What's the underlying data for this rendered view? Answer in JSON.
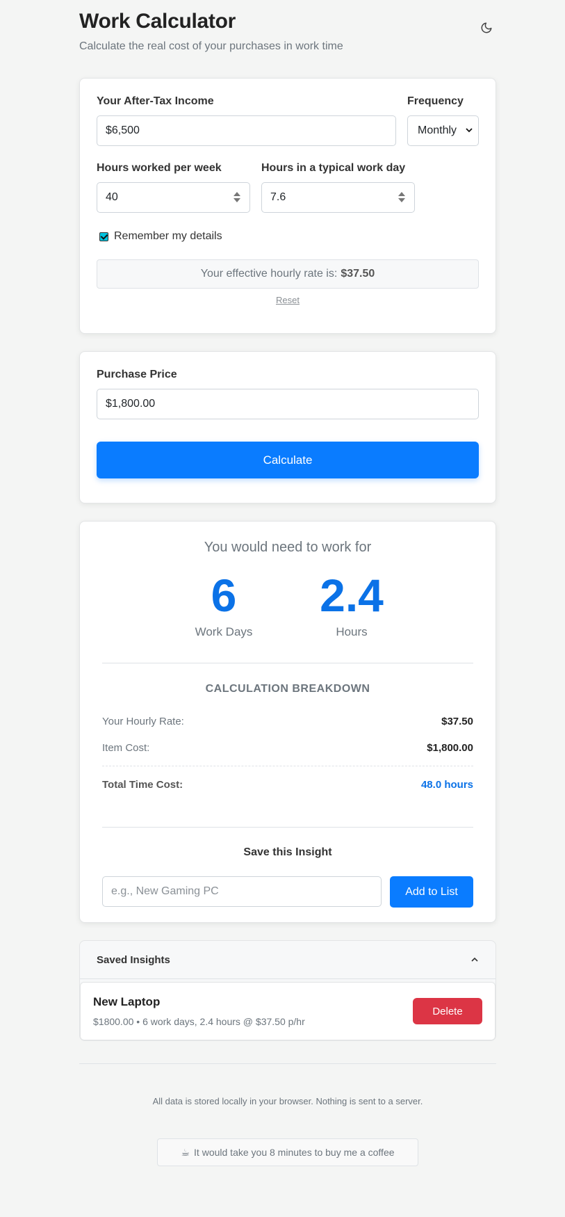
{
  "header": {
    "title": "Work Calculator",
    "subtitle": "Calculate the real cost of your purchases in work time",
    "theme_icon": "moon-icon"
  },
  "income": {
    "income_label": "Your After-Tax Income",
    "income_value": "$6,500",
    "frequency_label": "Frequency",
    "frequency_value": "Monthly",
    "hours_week_label": "Hours worked per week",
    "hours_week_value": "40",
    "hours_day_label": "Hours in a typical work day",
    "hours_day_value": "7.6",
    "remember_label": "Remember my details",
    "remember_checked": true,
    "rate_text": "Your effective hourly rate is:",
    "rate_value": "$37.50",
    "reset_label": "Reset"
  },
  "purchase": {
    "price_label": "Purchase Price",
    "price_value": "$1,800.00",
    "calculate_label": "Calculate"
  },
  "result": {
    "lead": "You would need to work for",
    "days_value": "6",
    "days_unit": "Work Days",
    "hours_value": "2.4",
    "hours_unit": "Hours",
    "breakdown_title": "CALCULATION BREAKDOWN",
    "rows": [
      {
        "label": "Your Hourly Rate:",
        "value": "$37.50"
      },
      {
        "label": "Item Cost:",
        "value": "$1,800.00"
      }
    ],
    "total_label": "Total Time Cost:",
    "total_value": "48.0 hours",
    "save_title": "Save this Insight",
    "save_placeholder": "e.g., New Gaming PC",
    "add_label": "Add to List"
  },
  "saved": {
    "title": "Saved Insights",
    "items": [
      {
        "name": "New Laptop",
        "detail": "$1800.00 • 6 work days, 2.4 hours @ $37.50 p/hr",
        "delete_label": "Delete"
      }
    ]
  },
  "footer": {
    "note": "All data is stored locally in your browser. Nothing is sent to a server.",
    "coffee_text": "It would take you 8 minutes to buy me a coffee"
  },
  "colors": {
    "primary": "#0a7cff",
    "danger": "#dc3545",
    "accent_text": "#0b72e7"
  }
}
